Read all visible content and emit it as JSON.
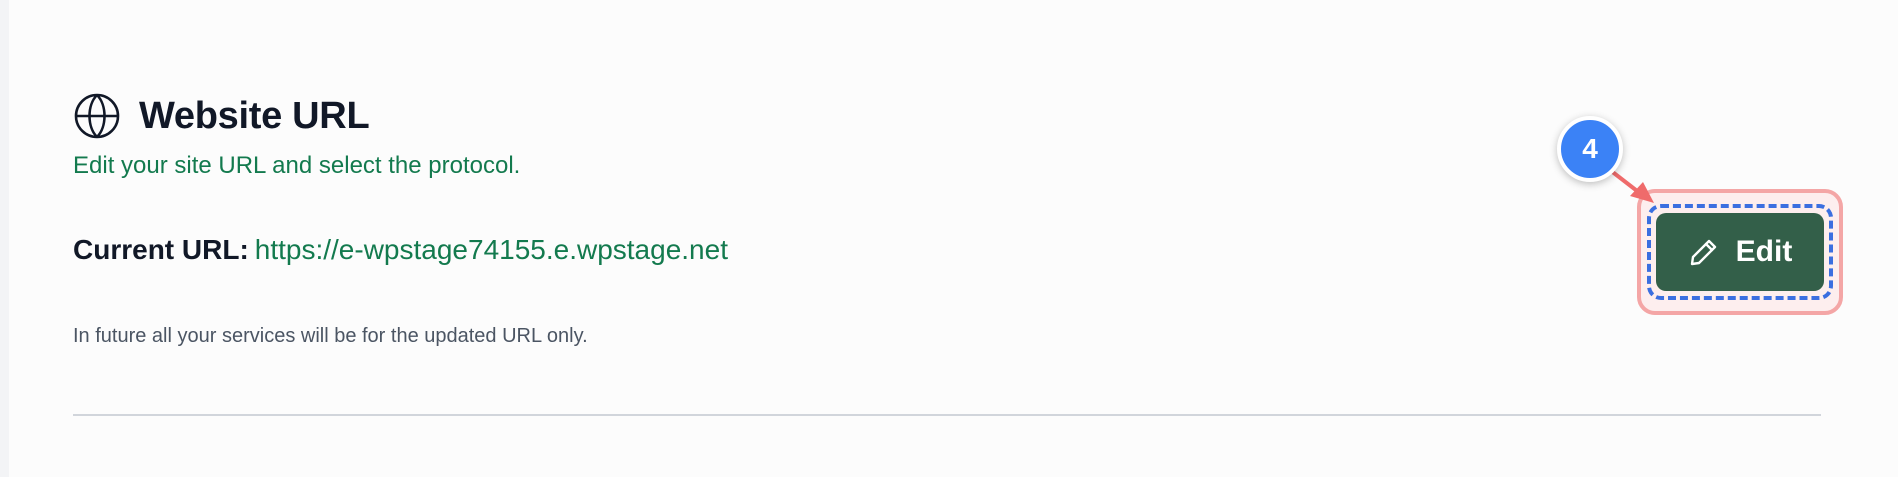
{
  "section": {
    "icon": "globe-icon",
    "title": "Website URL",
    "subtitle": "Edit your site URL and select the protocol.",
    "current_url_label": "Current URL:",
    "current_url_value": "https://e-wpstage74155.e.wpstage.net",
    "note": "In future all your services will be for the updated URL only."
  },
  "edit_button": {
    "label": "Edit",
    "icon": "pencil-icon"
  },
  "annotation": {
    "step_number": "4"
  },
  "colors": {
    "accent_green": "#137a4e",
    "button_green": "#335f49",
    "badge_blue": "#3b82f6",
    "highlight_red": "#f4a6a6"
  }
}
